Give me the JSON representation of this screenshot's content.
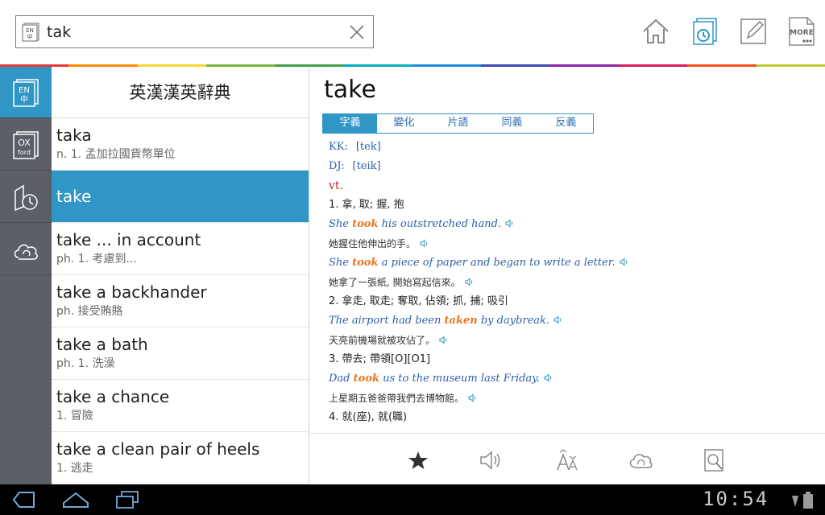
{
  "search": {
    "value": "tak",
    "lang_icon_top": "EN",
    "lang_icon_bottom": "中"
  },
  "toolbar": {
    "more_label": "MORE"
  },
  "rainbow_colors": [
    "#e53935",
    "#fb8c00",
    "#fdd835",
    "#7cb342",
    "#43a047",
    "#00acc1",
    "#1e88e5",
    "#3949ab",
    "#8e24aa",
    "#d81b60",
    "#f4511e",
    "#c0ca33"
  ],
  "rail": {
    "items": [
      {
        "name": "en-zh-dictionary",
        "label_top": "EN",
        "label_bottom": "中",
        "active": true
      },
      {
        "name": "oxford-dictionary",
        "label_top": "OX",
        "label_bottom": "ford",
        "active": false
      },
      {
        "name": "history",
        "active": false
      },
      {
        "name": "cloud-sync",
        "active": false
      }
    ]
  },
  "list": {
    "title": "英漢漢英辭典",
    "items": [
      {
        "word": "taka",
        "def": "n. 1. 孟加拉國貨幣單位"
      },
      {
        "word": "take",
        "def": "",
        "selected": true
      },
      {
        "word": "take ... in account",
        "def": "ph. 1. 考慮到..."
      },
      {
        "word": "take a backhander",
        "def": "ph. 接受賄賂"
      },
      {
        "word": "take a bath",
        "def": "ph. 1. 洗澡"
      },
      {
        "word": "take a chance",
        "def": "1. 冒險"
      },
      {
        "word": "take a clean pair of heels",
        "def": "1. 逃走"
      }
    ]
  },
  "detail": {
    "headword": "take",
    "tabs": [
      "字義",
      "變化",
      "片語",
      "同義",
      "反義"
    ],
    "kk_label": "KK:",
    "kk_value": "[tek]",
    "dj_label": "DJ:",
    "dj_value": "[teik]",
    "pos": "vt.",
    "senses": [
      {
        "def": "1. 拿, 取; 握, 抱",
        "ex_pre": "She ",
        "ex_hl": "took",
        "ex_post": " his outstretched hand.",
        "tr": "她握住他伸出的手。"
      },
      {
        "def": "",
        "ex_pre": "She ",
        "ex_hl": "took",
        "ex_post": " a piece of paper and began to write a letter.",
        "tr": "她拿了一張紙, 開始寫起信來。"
      },
      {
        "def": "2. 拿走, 取走; 奪取, 佔領; 抓, 捕; 吸引",
        "ex_pre": "The airport had been ",
        "ex_hl": "taken",
        "ex_post": " by daybreak.",
        "tr": "天亮前機場就被攻佔了。"
      },
      {
        "def": "3. 帶去; 帶領[O][O1]",
        "ex_pre": "Dad ",
        "ex_hl": "took",
        "ex_post": " us to the museum last Friday.",
        "tr": "上星期五爸爸帶我們去博物館。"
      },
      {
        "def": "4. 就(座), 就(職)",
        "ex_pre": "",
        "ex_hl": "",
        "ex_post": "",
        "tr": ""
      }
    ]
  },
  "status": {
    "clock": "10:54"
  }
}
